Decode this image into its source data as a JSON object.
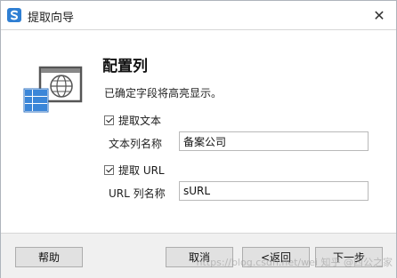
{
  "window": {
    "title": "提取向导",
    "close_glyph": "✕",
    "app_icon": "s-logo-icon"
  },
  "main": {
    "heading": "配置列",
    "description": "已确定字段将高亮显示。",
    "extract_text_checkbox": {
      "label": "提取文本",
      "checked": true
    },
    "text_column": {
      "label": "文本列名称",
      "value": "备案公司"
    },
    "extract_url_checkbox": {
      "label": "提取 URL",
      "checked": true
    },
    "url_column": {
      "label": "URL 列名称",
      "value": "sURL"
    }
  },
  "footer": {
    "help_label": "帮助",
    "cancel_label": "取消",
    "back_label": "<返回",
    "next_label": "下一步"
  },
  "watermark": "https://blog.csdn.net/wei 知乎 @四公之家",
  "colors": {
    "accent_blue": "#2f7fd3",
    "footer_bg": "#f0f0f0",
    "button_bg": "#e1e1e1"
  }
}
